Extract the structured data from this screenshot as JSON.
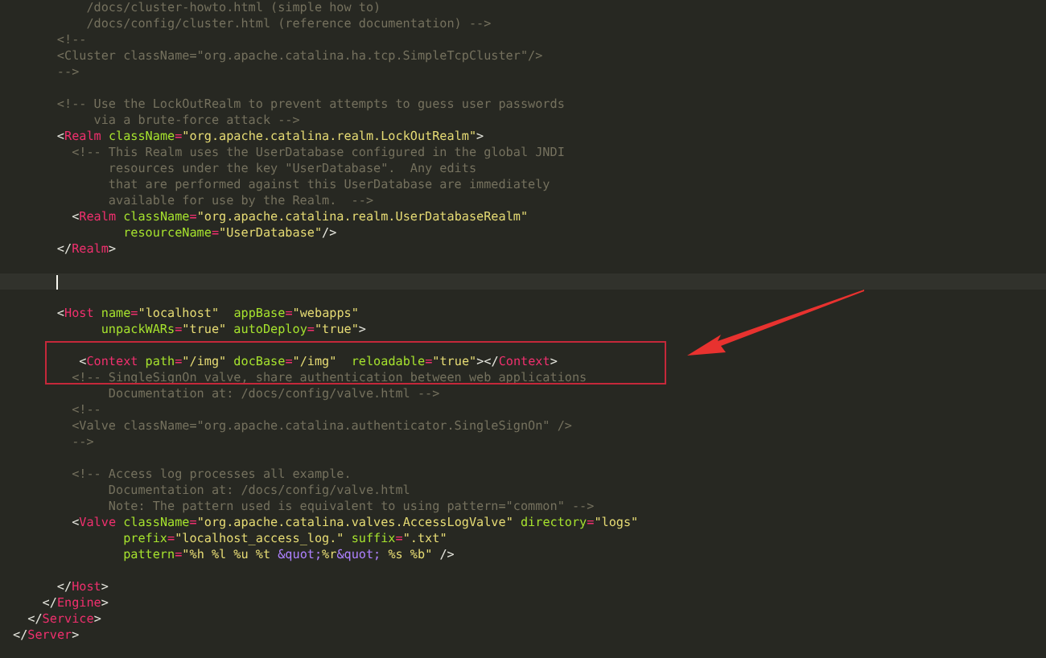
{
  "editor": {
    "lines": [
      {
        "kind": "code",
        "current": false,
        "tokens": [
          {
            "kind": "comment",
            "text": "          /docs/cluster-howto.html (simple how to)"
          }
        ]
      },
      {
        "kind": "code",
        "current": false,
        "tokens": [
          {
            "kind": "comment",
            "text": "          /docs/config/cluster.html (reference documentation) -->"
          }
        ]
      },
      {
        "kind": "code",
        "current": false,
        "tokens": [
          {
            "kind": "comment",
            "text": "      <!--"
          }
        ]
      },
      {
        "kind": "code",
        "current": false,
        "tokens": [
          {
            "kind": "comment",
            "text": "      <Cluster className=\"org.apache.catalina.ha.tcp.SimpleTcpCluster\"/>"
          }
        ]
      },
      {
        "kind": "code",
        "current": false,
        "tokens": [
          {
            "kind": "comment",
            "text": "      -->"
          }
        ]
      },
      {
        "kind": "blank",
        "current": false
      },
      {
        "kind": "code",
        "current": false,
        "tokens": [
          {
            "kind": "comment",
            "text": "      <!-- Use the LockOutRealm to prevent attempts to guess user passwords"
          }
        ]
      },
      {
        "kind": "code",
        "current": false,
        "tokens": [
          {
            "kind": "comment",
            "text": "           via a brute-force attack -->"
          }
        ]
      },
      {
        "kind": "code",
        "current": false,
        "tokens": [
          {
            "kind": "punct",
            "text": "      <"
          },
          {
            "kind": "tag",
            "text": "Realm"
          },
          {
            "kind": "attr",
            "text": " className"
          },
          {
            "kind": "op",
            "text": "="
          },
          {
            "kind": "value",
            "text": "\"org.apache.catalina.realm.LockOutRealm\""
          },
          {
            "kind": "punct",
            "text": ">"
          }
        ]
      },
      {
        "kind": "code",
        "current": false,
        "tokens": [
          {
            "kind": "comment",
            "text": "        <!-- This Realm uses the UserDatabase configured in the global JNDI"
          }
        ]
      },
      {
        "kind": "code",
        "current": false,
        "tokens": [
          {
            "kind": "comment",
            "text": "             resources under the key \"UserDatabase\".  Any edits"
          }
        ]
      },
      {
        "kind": "code",
        "current": false,
        "tokens": [
          {
            "kind": "comment",
            "text": "             that are performed against this UserDatabase are immediately"
          }
        ]
      },
      {
        "kind": "code",
        "current": false,
        "tokens": [
          {
            "kind": "comment",
            "text": "             available for use by the Realm.  -->"
          }
        ]
      },
      {
        "kind": "code",
        "current": false,
        "tokens": [
          {
            "kind": "punct",
            "text": "        <"
          },
          {
            "kind": "tag",
            "text": "Realm"
          },
          {
            "kind": "attr",
            "text": " className"
          },
          {
            "kind": "op",
            "text": "="
          },
          {
            "kind": "value",
            "text": "\"org.apache.catalina.realm.UserDatabaseRealm\""
          }
        ]
      },
      {
        "kind": "code",
        "current": false,
        "tokens": [
          {
            "kind": "attr",
            "text": "               resourceName"
          },
          {
            "kind": "op",
            "text": "="
          },
          {
            "kind": "value",
            "text": "\"UserDatabase\""
          },
          {
            "kind": "punct",
            "text": "/>"
          }
        ]
      },
      {
        "kind": "code",
        "current": false,
        "tokens": [
          {
            "kind": "punct",
            "text": "      </"
          },
          {
            "kind": "tag",
            "text": "Realm"
          },
          {
            "kind": "punct",
            "text": ">"
          }
        ]
      },
      {
        "kind": "blank",
        "current": false
      },
      {
        "kind": "blank",
        "current": true
      },
      {
        "kind": "blank",
        "current": false
      },
      {
        "kind": "code",
        "current": false,
        "tokens": [
          {
            "kind": "punct",
            "text": "      <"
          },
          {
            "kind": "tag",
            "text": "Host"
          },
          {
            "kind": "attr",
            "text": " name"
          },
          {
            "kind": "op",
            "text": "="
          },
          {
            "kind": "value",
            "text": "\"localhost\""
          },
          {
            "kind": "attr",
            "text": "  appBase"
          },
          {
            "kind": "op",
            "text": "="
          },
          {
            "kind": "value",
            "text": "\"webapps\""
          }
        ]
      },
      {
        "kind": "code",
        "current": false,
        "tokens": [
          {
            "kind": "attr",
            "text": "            unpackWARs"
          },
          {
            "kind": "op",
            "text": "="
          },
          {
            "kind": "value",
            "text": "\"true\""
          },
          {
            "kind": "attr",
            "text": " autoDeploy"
          },
          {
            "kind": "op",
            "text": "="
          },
          {
            "kind": "value",
            "text": "\"true\""
          },
          {
            "kind": "punct",
            "text": ">"
          }
        ]
      },
      {
        "kind": "blank",
        "current": false
      },
      {
        "kind": "code",
        "current": false,
        "tokens": [
          {
            "kind": "punct",
            "text": "         <"
          },
          {
            "kind": "tag",
            "text": "Context"
          },
          {
            "kind": "attr",
            "text": " path"
          },
          {
            "kind": "op",
            "text": "="
          },
          {
            "kind": "value",
            "text": "\"/img\""
          },
          {
            "kind": "attr",
            "text": " docBase"
          },
          {
            "kind": "op",
            "text": "="
          },
          {
            "kind": "value",
            "text": "\"/img\""
          },
          {
            "kind": "attr",
            "text": "  reloadable"
          },
          {
            "kind": "op",
            "text": "="
          },
          {
            "kind": "value",
            "text": "\"true\""
          },
          {
            "kind": "punct",
            "text": "></"
          },
          {
            "kind": "tag",
            "text": "Context"
          },
          {
            "kind": "punct",
            "text": ">"
          }
        ]
      },
      {
        "kind": "code",
        "current": false,
        "tokens": [
          {
            "kind": "comment",
            "text": "        <!-- SingleSignOn valve, share authentication between web applications"
          }
        ]
      },
      {
        "kind": "code",
        "current": false,
        "tokens": [
          {
            "kind": "comment",
            "text": "             Documentation at: /docs/config/valve.html -->"
          }
        ]
      },
      {
        "kind": "code",
        "current": false,
        "tokens": [
          {
            "kind": "comment",
            "text": "        <!--"
          }
        ]
      },
      {
        "kind": "code",
        "current": false,
        "tokens": [
          {
            "kind": "comment",
            "text": "        <Valve className=\"org.apache.catalina.authenticator.SingleSignOn\" />"
          }
        ]
      },
      {
        "kind": "code",
        "current": false,
        "tokens": [
          {
            "kind": "comment",
            "text": "        -->"
          }
        ]
      },
      {
        "kind": "blank",
        "current": false
      },
      {
        "kind": "code",
        "current": false,
        "tokens": [
          {
            "kind": "comment",
            "text": "        <!-- Access log processes all example."
          }
        ]
      },
      {
        "kind": "code",
        "current": false,
        "tokens": [
          {
            "kind": "comment",
            "text": "             Documentation at: /docs/config/valve.html"
          }
        ]
      },
      {
        "kind": "code",
        "current": false,
        "tokens": [
          {
            "kind": "comment",
            "text": "             Note: The pattern used is equivalent to using pattern=\"common\" -->"
          }
        ]
      },
      {
        "kind": "code",
        "current": false,
        "tokens": [
          {
            "kind": "punct",
            "text": "        <"
          },
          {
            "kind": "tag",
            "text": "Valve"
          },
          {
            "kind": "attr",
            "text": " className"
          },
          {
            "kind": "op",
            "text": "="
          },
          {
            "kind": "value",
            "text": "\"org.apache.catalina.valves.AccessLogValve\""
          },
          {
            "kind": "attr",
            "text": " directory"
          },
          {
            "kind": "op",
            "text": "="
          },
          {
            "kind": "value",
            "text": "\"logs\""
          }
        ]
      },
      {
        "kind": "code",
        "current": false,
        "tokens": [
          {
            "kind": "attr",
            "text": "               prefix"
          },
          {
            "kind": "op",
            "text": "="
          },
          {
            "kind": "value",
            "text": "\"localhost_access_log.\""
          },
          {
            "kind": "attr",
            "text": " suffix"
          },
          {
            "kind": "op",
            "text": "="
          },
          {
            "kind": "value",
            "text": "\".txt\""
          }
        ]
      },
      {
        "kind": "code",
        "current": false,
        "tokens": [
          {
            "kind": "attr",
            "text": "               pattern"
          },
          {
            "kind": "op",
            "text": "="
          },
          {
            "kind": "value",
            "text": "\"%h %l %u %t "
          },
          {
            "kind": "entity",
            "text": "&quot;"
          },
          {
            "kind": "value",
            "text": "%r"
          },
          {
            "kind": "entity",
            "text": "&quot;"
          },
          {
            "kind": "value",
            "text": " %s %b\""
          },
          {
            "kind": "punct",
            "text": " />"
          }
        ]
      },
      {
        "kind": "blank",
        "current": false
      },
      {
        "kind": "code",
        "current": false,
        "tokens": [
          {
            "kind": "punct",
            "text": "      </"
          },
          {
            "kind": "tag",
            "text": "Host"
          },
          {
            "kind": "punct",
            "text": ">"
          }
        ]
      },
      {
        "kind": "code",
        "current": false,
        "tokens": [
          {
            "kind": "punct",
            "text": "    </"
          },
          {
            "kind": "tag",
            "text": "Engine"
          },
          {
            "kind": "punct",
            "text": ">"
          }
        ]
      },
      {
        "kind": "code",
        "current": false,
        "tokens": [
          {
            "kind": "punct",
            "text": "  </"
          },
          {
            "kind": "tag",
            "text": "Service"
          },
          {
            "kind": "punct",
            "text": ">"
          }
        ]
      },
      {
        "kind": "code",
        "current": false,
        "tokens": [
          {
            "kind": "punct",
            "text": "</"
          },
          {
            "kind": "tag",
            "text": "Server"
          },
          {
            "kind": "punct",
            "text": ">"
          }
        ]
      }
    ]
  }
}
